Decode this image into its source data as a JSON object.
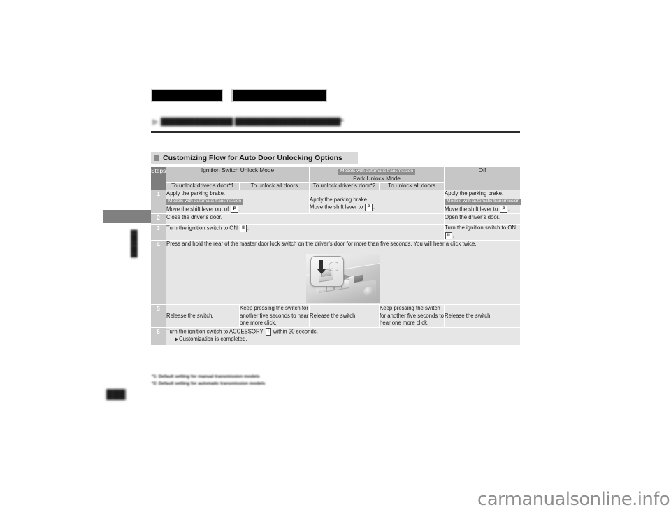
{
  "document": {
    "page_number": "███",
    "chapter_tab_label": "███████",
    "breadcrumb": "███████████████ ██████████████████████*",
    "header_box_a": "",
    "header_box_b": "",
    "watermark": "carmanualsonline.info"
  },
  "section": {
    "title": "Customizing Flow for Auto Door Unlocking Options"
  },
  "table": {
    "steps_header": "Steps",
    "groups": [
      {
        "label": "Ignition Switch Unlock Mode",
        "badge": ""
      },
      {
        "label": "Park Unlock Mode",
        "badge": "Models with automatic transmission"
      },
      {
        "label": "Off",
        "badge": ""
      }
    ],
    "subheaders": [
      "To unlock driver’s door*1",
      "To unlock all doors",
      "To unlock driver’s door*2",
      "To unlock all doors"
    ],
    "rows": [
      {
        "step": "1",
        "cells": [
          {
            "colspan": 2,
            "lines": [
              "Apply the parking brake."
            ],
            "badge": "Models with automatic transmission",
            "after_badge_pre": "Move the shift lever out of ",
            "key": "P",
            "after_badge_post": "."
          },
          {
            "colspan": 2,
            "lines": [
              "Apply the parking brake."
            ],
            "badge": "",
            "after_badge_pre": "Move the shift lever to ",
            "key": "P",
            "after_badge_post": "."
          },
          {
            "colspan": 1,
            "lines": [
              "Apply the parking brake."
            ],
            "badge": "Models with automatic transmission",
            "after_badge_pre": "Move the shift lever to ",
            "key": "P",
            "after_badge_post": "."
          }
        ]
      },
      {
        "step": "2",
        "cells": [
          {
            "colspan": 4,
            "text": "Close the driver’s door."
          },
          {
            "colspan": 1,
            "text": "Open the driver’s door."
          }
        ]
      },
      {
        "step": "3",
        "cells": [
          {
            "colspan": 4,
            "pre": "Turn the ignition switch to ON ",
            "key": "II",
            "post": "."
          },
          {
            "colspan": 1,
            "pre": "Turn the ignition switch to ON ",
            "key": "II",
            "post": "."
          }
        ]
      },
      {
        "step": "4",
        "cells": [
          {
            "colspan": 5,
            "text": "Press and hold the rear of the master door lock switch on the driver’s door for more than five seconds. You will hear a click twice.",
            "illustration": "door-lock-switch-photo"
          }
        ]
      },
      {
        "step": "5",
        "cells": [
          {
            "colspan": 1,
            "text": "Release the switch."
          },
          {
            "colspan": 1,
            "text": "Keep pressing the switch for another five seconds to hear one more click."
          },
          {
            "colspan": 1,
            "text": "Release the switch."
          },
          {
            "colspan": 1,
            "text": "Keep pressing the switch for another five seconds to hear one more click."
          },
          {
            "colspan": 1,
            "text": "Release the switch."
          }
        ]
      },
      {
        "step": "6",
        "cells": [
          {
            "colspan": 5,
            "pre": "Turn the ignition switch to ACCESSORY ",
            "key": "I",
            "post": " within 20 seconds.",
            "sub": "Customization is completed."
          }
        ]
      }
    ]
  },
  "footnotes": [
    "*1: Default setting for manual transmission models",
    "*2: Default setting for automatic transmission models"
  ],
  "colors": {
    "steps_header_bg": "#7d7d7d",
    "group_header_bg": "#c6c6c6",
    "sub_header_bg": "#d2d2d2",
    "step_number_bg": "#c9c9c9",
    "body_cell_bg": "#e6e6e6",
    "section_title_bg": "#d9d9d9",
    "chapter_tab_bg": "#808080",
    "watermark": "#8f8f8f"
  }
}
